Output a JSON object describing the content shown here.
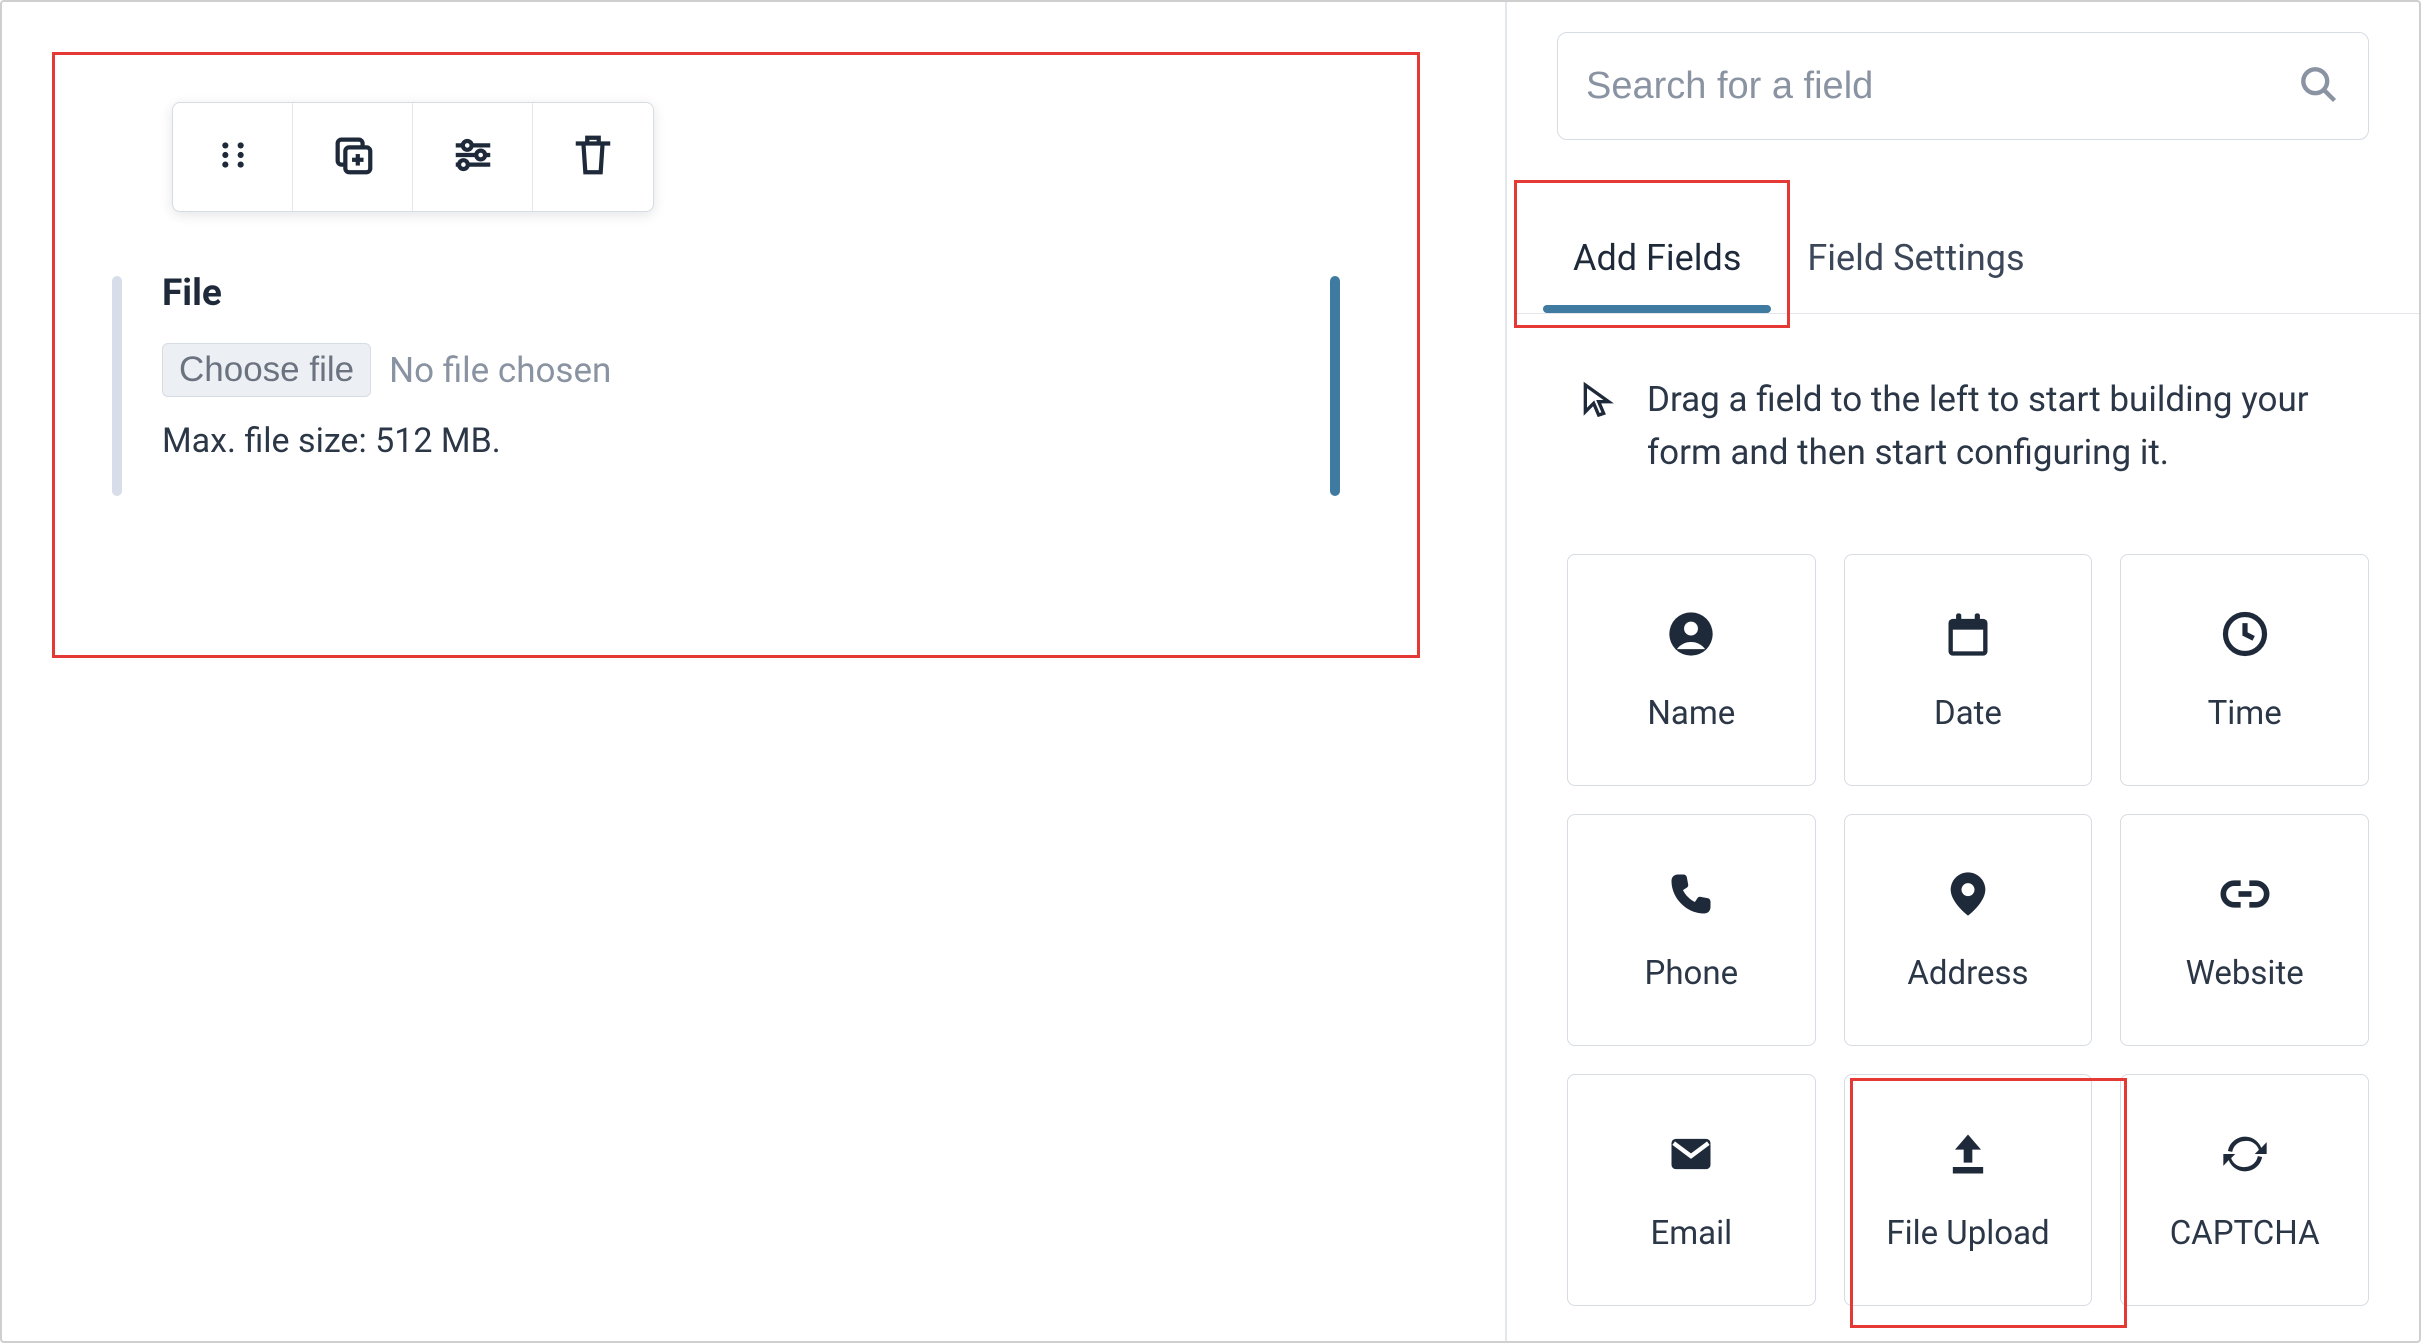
{
  "colors": {
    "accent": "#3f7ba0",
    "highlight": "#e53935",
    "icon": "#1e2a3a",
    "border": "#d7dbe3"
  },
  "canvas": {
    "field": {
      "label": "File",
      "choose_button": "Choose file",
      "no_file_text": "No file chosen",
      "hint": "Max. file size: 512 MB."
    },
    "toolbar": {
      "drag": "drag-handle",
      "duplicate": "duplicate",
      "settings": "settings",
      "delete": "delete"
    }
  },
  "sidebar": {
    "search": {
      "placeholder": "Search for a field"
    },
    "tabs": [
      {
        "id": "add-fields",
        "label": "Add Fields",
        "active": true
      },
      {
        "id": "field-settings",
        "label": "Field Settings",
        "active": false
      }
    ],
    "instruction": "Drag a field to the left to start building your form and then start configuring it.",
    "fields": [
      {
        "id": "name",
        "label": "Name",
        "icon": "person"
      },
      {
        "id": "date",
        "label": "Date",
        "icon": "calendar"
      },
      {
        "id": "time",
        "label": "Time",
        "icon": "clock"
      },
      {
        "id": "phone",
        "label": "Phone",
        "icon": "phone"
      },
      {
        "id": "address",
        "label": "Address",
        "icon": "pin"
      },
      {
        "id": "website",
        "label": "Website",
        "icon": "link"
      },
      {
        "id": "email",
        "label": "Email",
        "icon": "mail"
      },
      {
        "id": "file-upload",
        "label": "File Upload",
        "icon": "upload"
      },
      {
        "id": "captcha",
        "label": "CAPTCHA",
        "icon": "refresh"
      }
    ]
  }
}
